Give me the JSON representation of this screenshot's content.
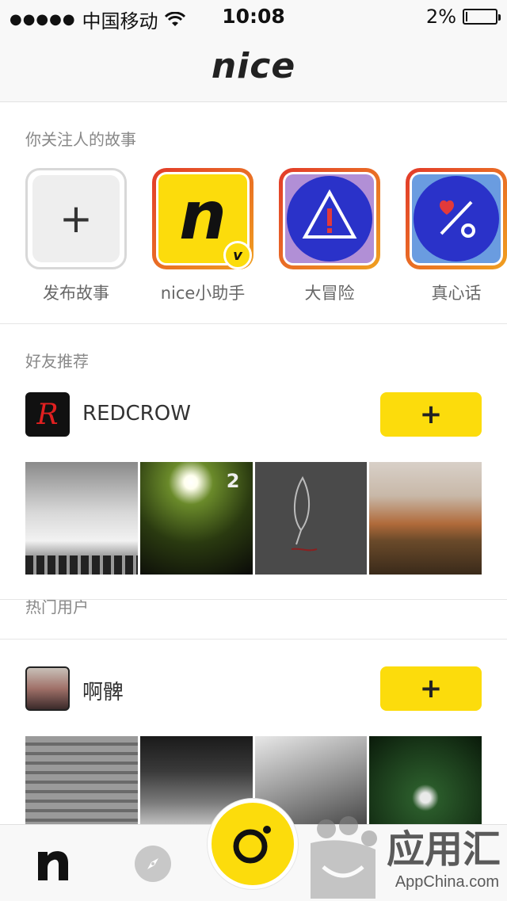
{
  "status_bar": {
    "signal_dots": "●●●●●",
    "carrier": "中国移动",
    "time": "10:08",
    "battery_percent": "2%"
  },
  "nav": {
    "logo": "nice"
  },
  "stories": {
    "title": "你关注人的故事",
    "items": [
      {
        "label": "发布故事",
        "type": "add",
        "glyph": "+"
      },
      {
        "label": "nice小助手",
        "type": "ring",
        "glyph": "n",
        "badge": "v"
      },
      {
        "label": "大冒险",
        "type": "ring",
        "glyph": "!"
      },
      {
        "label": "真心话",
        "type": "ring",
        "glyph": "%"
      }
    ]
  },
  "recommend": {
    "title": "好友推荐",
    "user": {
      "name": "REDCROW",
      "avatar_glyph": "R",
      "follow_label": "+"
    },
    "thumb_badge": "2"
  },
  "popular": {
    "title": "热门用户",
    "user": {
      "name": "啊髀",
      "follow_label": "+"
    }
  },
  "tabbar": {
    "items": [
      "home-tab",
      "discover-tab",
      "camera-tab"
    ]
  },
  "watermark": {
    "text": "应用汇",
    "sub": "AppChina.com"
  },
  "colors": {
    "accent": "#fcdc0c",
    "ring_start": "#e23a2a",
    "ring_end": "#f0a020"
  }
}
